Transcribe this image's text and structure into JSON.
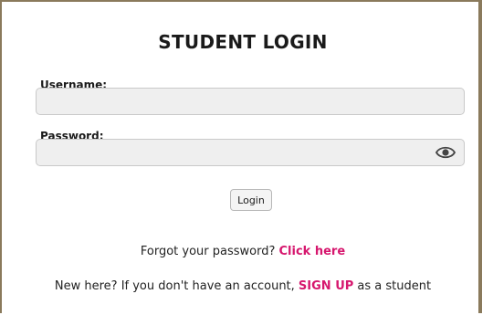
{
  "form": {
    "title": "STUDENT LOGIN",
    "username_label": "Username:",
    "username_value": "",
    "password_label": "Password:",
    "password_value": "",
    "login_label": "Login"
  },
  "forgot": {
    "text": "Forgot your password? ",
    "link": "Click here"
  },
  "signup": {
    "text_before": "New here? If you don't have an account, ",
    "link": "SIGN UP",
    "text_after": " as a student"
  },
  "colors": {
    "accent": "#d6176e",
    "frame": "#8a7a5c",
    "field_bg": "#efefef"
  },
  "icons": {
    "password_toggle": "eye-icon"
  }
}
